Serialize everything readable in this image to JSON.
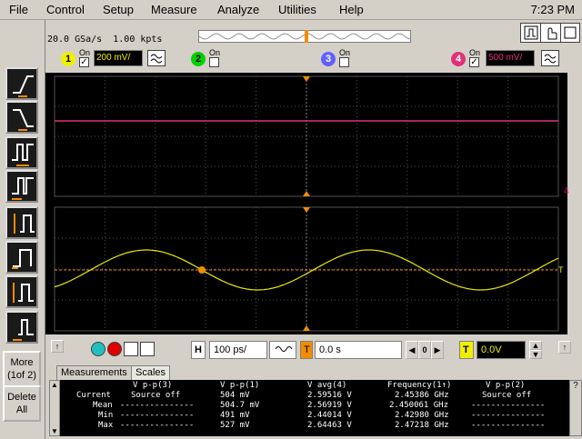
{
  "menu": {
    "items": [
      "File",
      "Control",
      "Setup",
      "Measure",
      "Analyze",
      "Utilities",
      "Help"
    ],
    "clock": "7:23 PM"
  },
  "acquisition": {
    "sample_rate": "20.0 GSa/s",
    "memory_depth": "1.00 kpts"
  },
  "channels": [
    {
      "number": "1",
      "on_label": "On",
      "checked": "✓",
      "scale": "200 mV/",
      "color": "#f0f000",
      "scale_color": "#f0f000"
    },
    {
      "number": "2",
      "on_label": "On",
      "checked": "",
      "color": "#00d000"
    },
    {
      "number": "3",
      "on_label": "On",
      "checked": "",
      "color": "#6060ff"
    },
    {
      "number": "4",
      "on_label": "On",
      "checked": "✓",
      "scale": "500 mV/",
      "color": "#e0307a",
      "scale_color": "#e0307a"
    }
  ],
  "display": {
    "trace_ch4_color": "#e0307a",
    "trace_ch1_color": "#e8e800",
    "trigger_level_color": "#f28c00",
    "grid_color": "#505050",
    "channel4_marker": "4",
    "trigger_marker": "T"
  },
  "side_buttons": {
    "more_line1": "More",
    "more_line2": "(1of 2)",
    "delete_line1": "Delete",
    "delete_line2": "All"
  },
  "controls": {
    "horizontal_label": "H",
    "timebase": "100 ps/",
    "trigger_badge": "T",
    "position": "0.0 s",
    "position_zero": "0",
    "trigger_label": "T",
    "trigger_level": "0.0V"
  },
  "measurements": {
    "tabs": [
      "Measurements",
      "Scales"
    ],
    "help": "?",
    "headers": [
      "V p-p(3)",
      "V p-p(1)",
      "V avg(4)",
      "Frequency(1↑)",
      "V p-p(2)"
    ],
    "rows": [
      {
        "label": "Current",
        "values": [
          "Source off",
          "504 mV",
          "2.59516 V",
          "2.45386 GHz",
          "Source off"
        ]
      },
      {
        "label": "Mean",
        "values": [
          "---------------",
          "504.7 mV",
          "2.56919 V",
          "2.450061 GHz",
          "---------------"
        ]
      },
      {
        "label": "Min",
        "values": [
          "---------------",
          "491 mV",
          "2.44014 V",
          "2.42980 GHz",
          "---------------"
        ]
      },
      {
        "label": "Max",
        "values": [
          "---------------",
          "527 mV",
          "2.64463 V",
          "2.47218 GHz",
          "---------------"
        ]
      }
    ]
  }
}
